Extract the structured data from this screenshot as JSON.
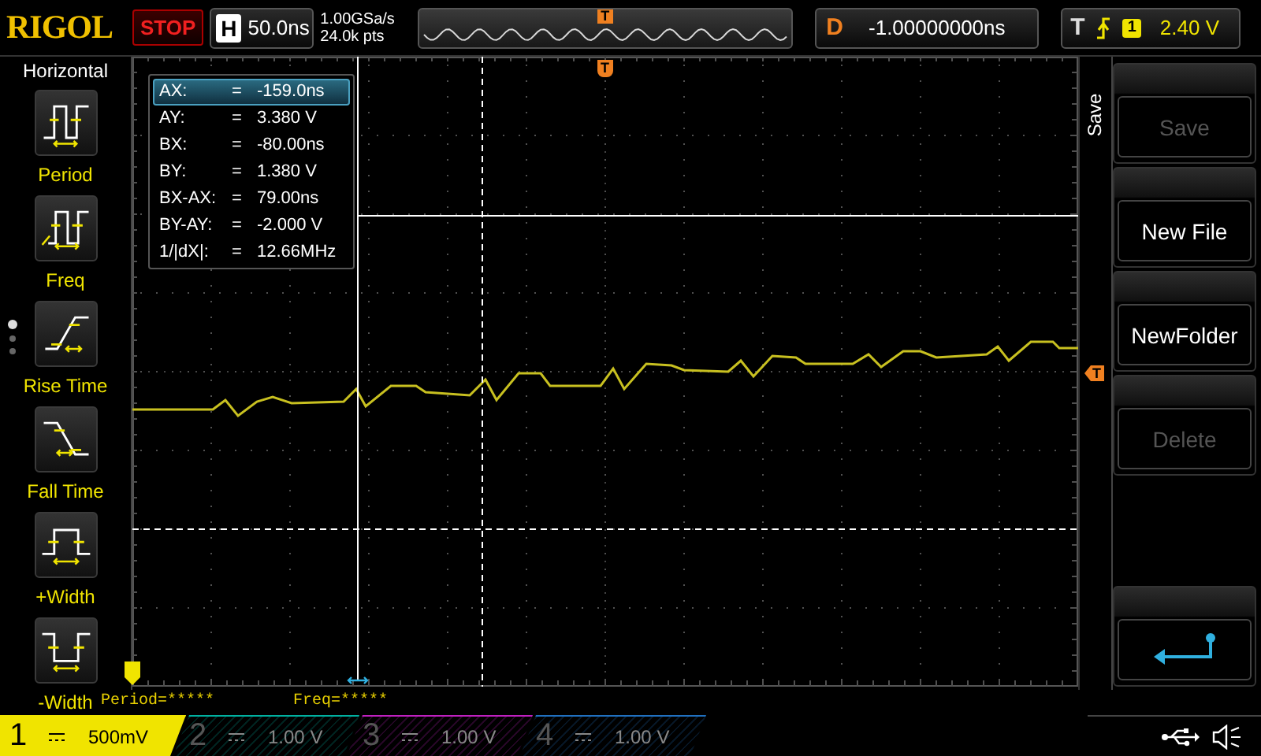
{
  "top_bar": {
    "logo": "RIGOL",
    "run_state": "STOP",
    "timebase": {
      "label": "H",
      "value": "50.0ns"
    },
    "sample_rate": "1.00GSa/s",
    "memory_depth": "24.0k pts",
    "overview_trigger_marker": "T",
    "delay": {
      "label": "D",
      "value": "-1.00000000ns"
    },
    "trigger": {
      "label": "T",
      "source": "1",
      "level": "2.40 V"
    }
  },
  "left_menu": {
    "title": "Horizontal",
    "items": [
      {
        "label": "Period",
        "kind": "period"
      },
      {
        "label": "Freq",
        "kind": "freq"
      },
      {
        "label": "Rise Time",
        "kind": "rise"
      },
      {
        "label": "Fall Time",
        "kind": "fall"
      },
      {
        "label": "+Width",
        "kind": "pwidth"
      },
      {
        "label": "-Width",
        "kind": "nwidth"
      }
    ],
    "pages": [
      {
        "selected": true
      },
      {
        "selected": false
      },
      {
        "selected": false
      }
    ]
  },
  "screen": {
    "trigger_position_marker": "T",
    "trigger_level_marker": "T"
  },
  "cursor_readout": [
    {
      "name": "AX:",
      "equals": "=",
      "value": "-159.0ns",
      "selected": true
    },
    {
      "name": "AY:",
      "equals": "=",
      "value": "3.380 V",
      "selected": false
    },
    {
      "name": "BX:",
      "equals": "=",
      "value": "-80.00ns",
      "selected": false
    },
    {
      "name": "BY:",
      "equals": "=",
      "value": "1.380 V",
      "selected": false
    },
    {
      "name": "BX-AX:",
      "equals": "=",
      "value": "79.00ns",
      "selected": false
    },
    {
      "name": "BY-AY:",
      "equals": "=",
      "value": "-2.000 V",
      "selected": false
    },
    {
      "name": "1/|dX|:",
      "equals": "=",
      "value": "12.66MHz",
      "selected": false
    }
  ],
  "measurements": [
    "Period=*****",
    "Freq=*****"
  ],
  "right_menu": {
    "title": "Save",
    "items": [
      {
        "kind": "text",
        "label": "Save",
        "disabled": true
      },
      {
        "kind": "text",
        "label": "New File",
        "disabled": false
      },
      {
        "kind": "text",
        "label": "NewFolder",
        "disabled": false
      },
      {
        "kind": "text",
        "label": "Delete",
        "disabled": true
      },
      {
        "kind": "back"
      }
    ]
  },
  "channels": [
    {
      "number": "1",
      "value": "500mV",
      "active": true,
      "color": "#f0e400"
    },
    {
      "number": "2",
      "value": "1.00 V",
      "active": false,
      "color": "#00b0a0"
    },
    {
      "number": "3",
      "value": "1.00 V",
      "active": false,
      "color": "#c020c0"
    },
    {
      "number": "4",
      "value": "1.00 V",
      "active": false,
      "color": "#2070c0"
    }
  ]
}
